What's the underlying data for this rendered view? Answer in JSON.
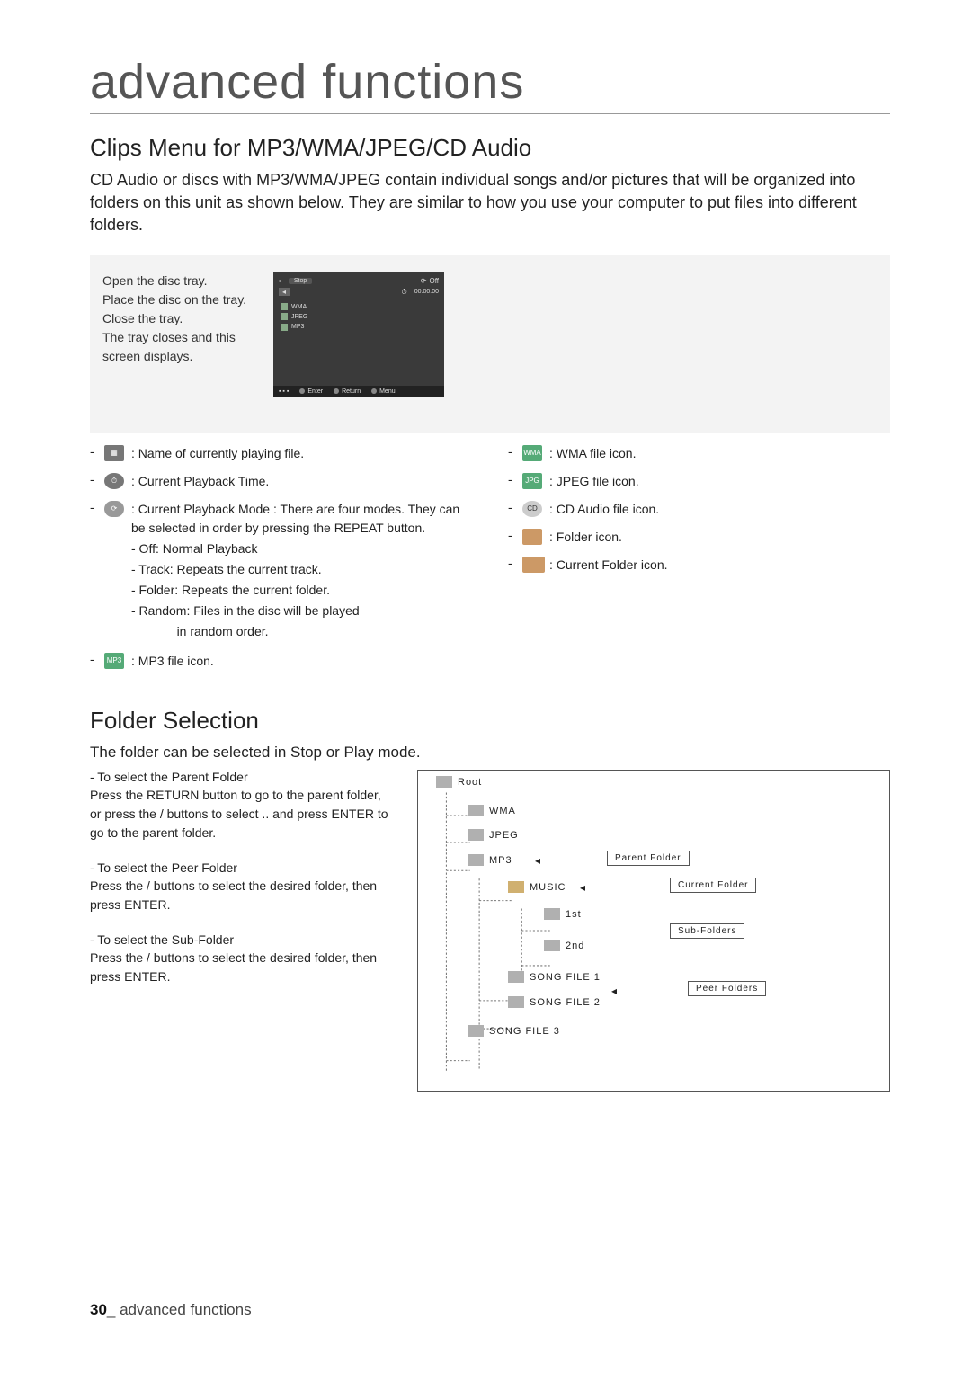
{
  "title": "advanced functions",
  "section1": {
    "heading": "Clips Menu for MP3/WMA/JPEG/CD Audio",
    "intro": "CD Audio or discs with MP3/WMA/JPEG contain individual songs and/or pictures that will be organized into folders on this unit as shown below.  They are similar to how you use your computer to put files into different folders.",
    "panel": {
      "steps": "Open the disc tray.\nPlace the disc on the tray.\nClose the tray.\nThe tray closes and this screen displays.",
      "screen": {
        "stop": "Stop",
        "off": "Off",
        "time": "00:00:00",
        "files": [
          "WMA",
          "JPEG",
          "MP3"
        ],
        "bar": {
          "enter": "Enter",
          "return": "Return",
          "menu": "Menu"
        }
      }
    },
    "legend_left": [
      {
        "icon": "doc-icon",
        "text": ": Name of currently playing file."
      },
      {
        "icon": "clock-icon",
        "text": ": Current Playback Time."
      },
      {
        "icon": "repeat-icon",
        "text": ": Current Playback Mode : There are four modes. They can be selected in order by pressing the REPEAT button.",
        "sub": [
          "- Off: Normal Playback",
          "- Track: Repeats the current track.",
          "- Folder: Repeats the current folder.",
          "- Random: Files in the disc will be played",
          "             in random order."
        ]
      },
      {
        "icon": "mp3-icon",
        "text": ": MP3 file icon."
      }
    ],
    "legend_right": [
      {
        "icon": "wma-icon",
        "text": ": WMA file icon."
      },
      {
        "icon": "jpeg-icon",
        "text": ": JPEG file icon."
      },
      {
        "icon": "cd-icon",
        "text": ": CD Audio  file icon."
      },
      {
        "icon": "folder-icon",
        "text": ": Folder icon."
      },
      {
        "icon": "current-folder-icon",
        "text": ": Current Folder icon."
      }
    ]
  },
  "section2": {
    "heading": "Folder Selection",
    "intro": "The folder can be selected in Stop or Play mode.",
    "items": [
      {
        "head": "-  To select the Parent Folder",
        "body": "Press the RETURN button to go to the parent folder, or press the    /    buttons to select  ..  and press ENTER to go to the parent folder."
      },
      {
        "head": "-  To select the Peer Folder",
        "body": "Press the    /    buttons to select the desired folder, then press ENTER."
      },
      {
        "head": "-  To select the Sub-Folder",
        "body": "Press the    /    buttons to select the desired folder, then press ENTER."
      }
    ],
    "tree": {
      "root": "Root",
      "n1": "WMA",
      "n2": "JPEG",
      "n3": "MP3",
      "n4": "MUSIC",
      "n5": "1st",
      "n6": "2nd",
      "n7": "SONG FILE 1",
      "n8": "SONG FILE 2",
      "n9": "SONG FILE 3",
      "lbl_parent": "Parent Folder",
      "lbl_current": "Current Folder",
      "lbl_sub": "Sub-Folders",
      "lbl_peer": "Peer Folders"
    }
  },
  "footer": {
    "page": "30",
    "label": "_ advanced functions"
  }
}
